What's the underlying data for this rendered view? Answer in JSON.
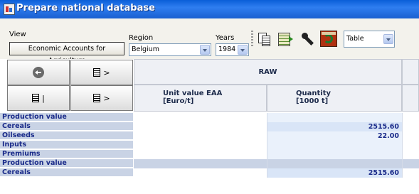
{
  "window": {
    "title": "Prepare national database"
  },
  "controls": {
    "view_label": "View",
    "view_button": "Economic Accounts for Agriculture",
    "region_label": "Region",
    "region_value": "Belgium",
    "years_label": "Years",
    "years_value": "1984",
    "display_value": "Table"
  },
  "toolbar_icons": [
    "copy-icon",
    "grid-export-icon",
    "wrench-icon",
    "refresh-icon"
  ],
  "nav_buttons": [
    {
      "name": "back",
      "symbol": ""
    },
    {
      "name": "next-column",
      "symbol": ">"
    },
    {
      "name": "first-column",
      "symbol": "|"
    },
    {
      "name": "next-page",
      "symbol": ">"
    }
  ],
  "table": {
    "group_header": "RAW",
    "columns": [
      {
        "name": "Unit value EAA",
        "unit": "[Euro/t]"
      },
      {
        "name": "Quantity",
        "unit": "[1000 t]"
      }
    ],
    "rows": [
      {
        "label": "Production value",
        "unit_value": "",
        "quantity": "",
        "sep": false
      },
      {
        "label": "Cereals",
        "unit_value": "",
        "quantity": "2515.60",
        "sep": false
      },
      {
        "label": "Oilseeds",
        "unit_value": "",
        "quantity": "22.00",
        "sep": false
      },
      {
        "label": "Inputs",
        "unit_value": "",
        "quantity": "",
        "sep": false
      },
      {
        "label": "Premiums",
        "unit_value": "",
        "quantity": "",
        "sep": false
      },
      {
        "label": "Production value",
        "unit_value": "",
        "quantity": "",
        "sep": true
      },
      {
        "label": "Cereals",
        "unit_value": "",
        "quantity": "2515.60",
        "sep": false
      }
    ]
  },
  "colors": {
    "title_bar": "#1a5fd0",
    "row_label_bg": "#c9d3e5",
    "value_text": "#1a2b8a"
  }
}
